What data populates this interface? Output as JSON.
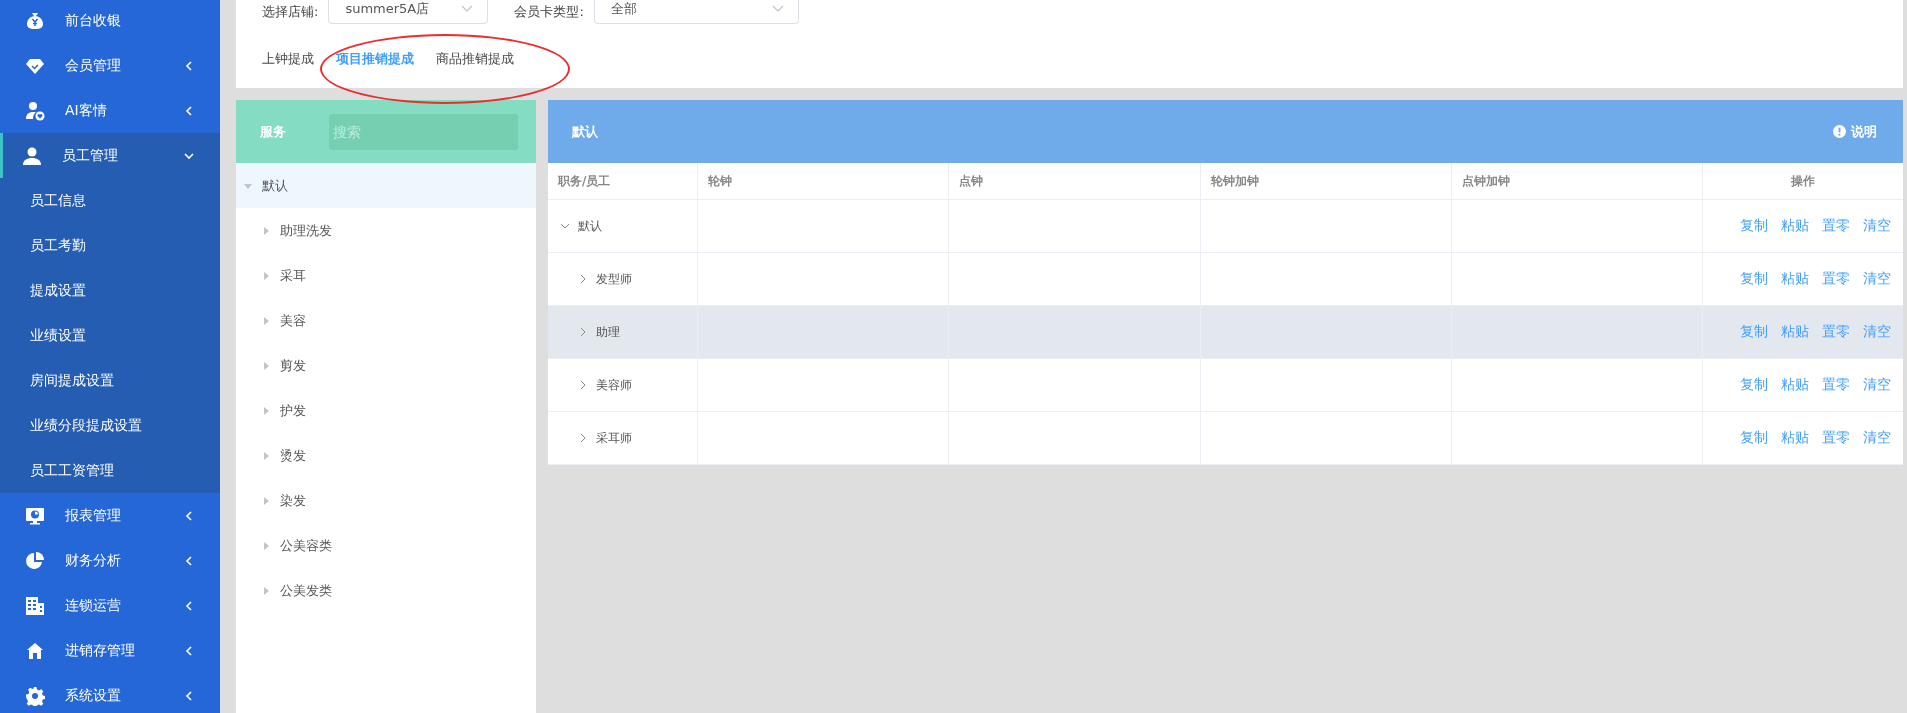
{
  "sidebar": {
    "items": [
      {
        "label": "前台收银",
        "kind": "link",
        "selected": false
      },
      {
        "label": "会员管理",
        "kind": "group",
        "expanded": false,
        "selected": false
      },
      {
        "label": "AI客情",
        "kind": "group",
        "expanded": false,
        "selected": false
      },
      {
        "label": "员工管理",
        "kind": "group",
        "expanded": true,
        "selected": true,
        "children": [
          {
            "label": "员工信息",
            "selected": false
          },
          {
            "label": "员工考勤",
            "selected": false
          },
          {
            "label": "提成设置",
            "selected": false
          },
          {
            "label": "业绩设置",
            "selected": false
          },
          {
            "label": "房间提成设置",
            "selected": false
          },
          {
            "label": "业绩分段提成设置",
            "selected": false
          },
          {
            "label": "员工工资管理",
            "selected": false
          }
        ]
      },
      {
        "label": "报表管理",
        "kind": "group",
        "expanded": false,
        "selected": false
      },
      {
        "label": "财务分析",
        "kind": "group",
        "expanded": false,
        "selected": false
      },
      {
        "label": "连锁运营",
        "kind": "group",
        "expanded": false,
        "selected": false
      },
      {
        "label": "进销存管理",
        "kind": "group",
        "expanded": false,
        "selected": false
      },
      {
        "label": "系统设置",
        "kind": "group",
        "expanded": false,
        "selected": false
      }
    ]
  },
  "filters": [
    {
      "label": "选择店铺:",
      "value": "summer5A店"
    },
    {
      "label": "会员卡类型:",
      "value": "全部"
    }
  ],
  "tabs": [
    {
      "label": "上钟提成",
      "selected": false
    },
    {
      "label": "项目推销提成",
      "selected": true
    },
    {
      "label": "商品推销提成",
      "selected": false
    }
  ],
  "service_panel": {
    "title": "服务",
    "search": {
      "placeholder": "搜索"
    },
    "tree": [
      {
        "label": "默认",
        "expanded": true,
        "selected": true,
        "children": [
          {
            "label": "助理洗发",
            "expanded": false
          },
          {
            "label": "采耳",
            "expanded": false
          },
          {
            "label": "美容",
            "expanded": false
          },
          {
            "label": "剪发",
            "expanded": false
          },
          {
            "label": "护发",
            "expanded": false
          },
          {
            "label": "烫发",
            "expanded": false
          },
          {
            "label": "染发",
            "expanded": false
          },
          {
            "label": "公美容类",
            "expanded": false
          },
          {
            "label": "公美发类",
            "expanded": false
          }
        ]
      }
    ]
  },
  "commission_panel": {
    "title": "默认",
    "help_link": "说明",
    "table": {
      "columns": [
        "职务/员工",
        "轮钟",
        "点钟",
        "轮钟加钟",
        "点钟加钟",
        "操作"
      ],
      "rows": [
        {
          "label": "默认",
          "expanded": true,
          "hovered": false,
          "actions": [
            "复制",
            "粘贴",
            "置零",
            "清空"
          ],
          "children": [
            {
              "label": "发型师",
              "expanded": false,
              "hovered": false,
              "actions": [
                "复制",
                "粘贴",
                "置零",
                "清空"
              ]
            },
            {
              "label": "助理",
              "expanded": false,
              "hovered": true,
              "actions": [
                "复制",
                "粘贴",
                "置零",
                "清空"
              ]
            },
            {
              "label": "美容师",
              "expanded": false,
              "hovered": false,
              "actions": [
                "复制",
                "粘贴",
                "置零",
                "清空"
              ]
            },
            {
              "label": "采耳师",
              "expanded": false,
              "hovered": false,
              "actions": [
                "复制",
                "粘贴",
                "置零",
                "清空"
              ]
            }
          ]
        }
      ]
    }
  }
}
